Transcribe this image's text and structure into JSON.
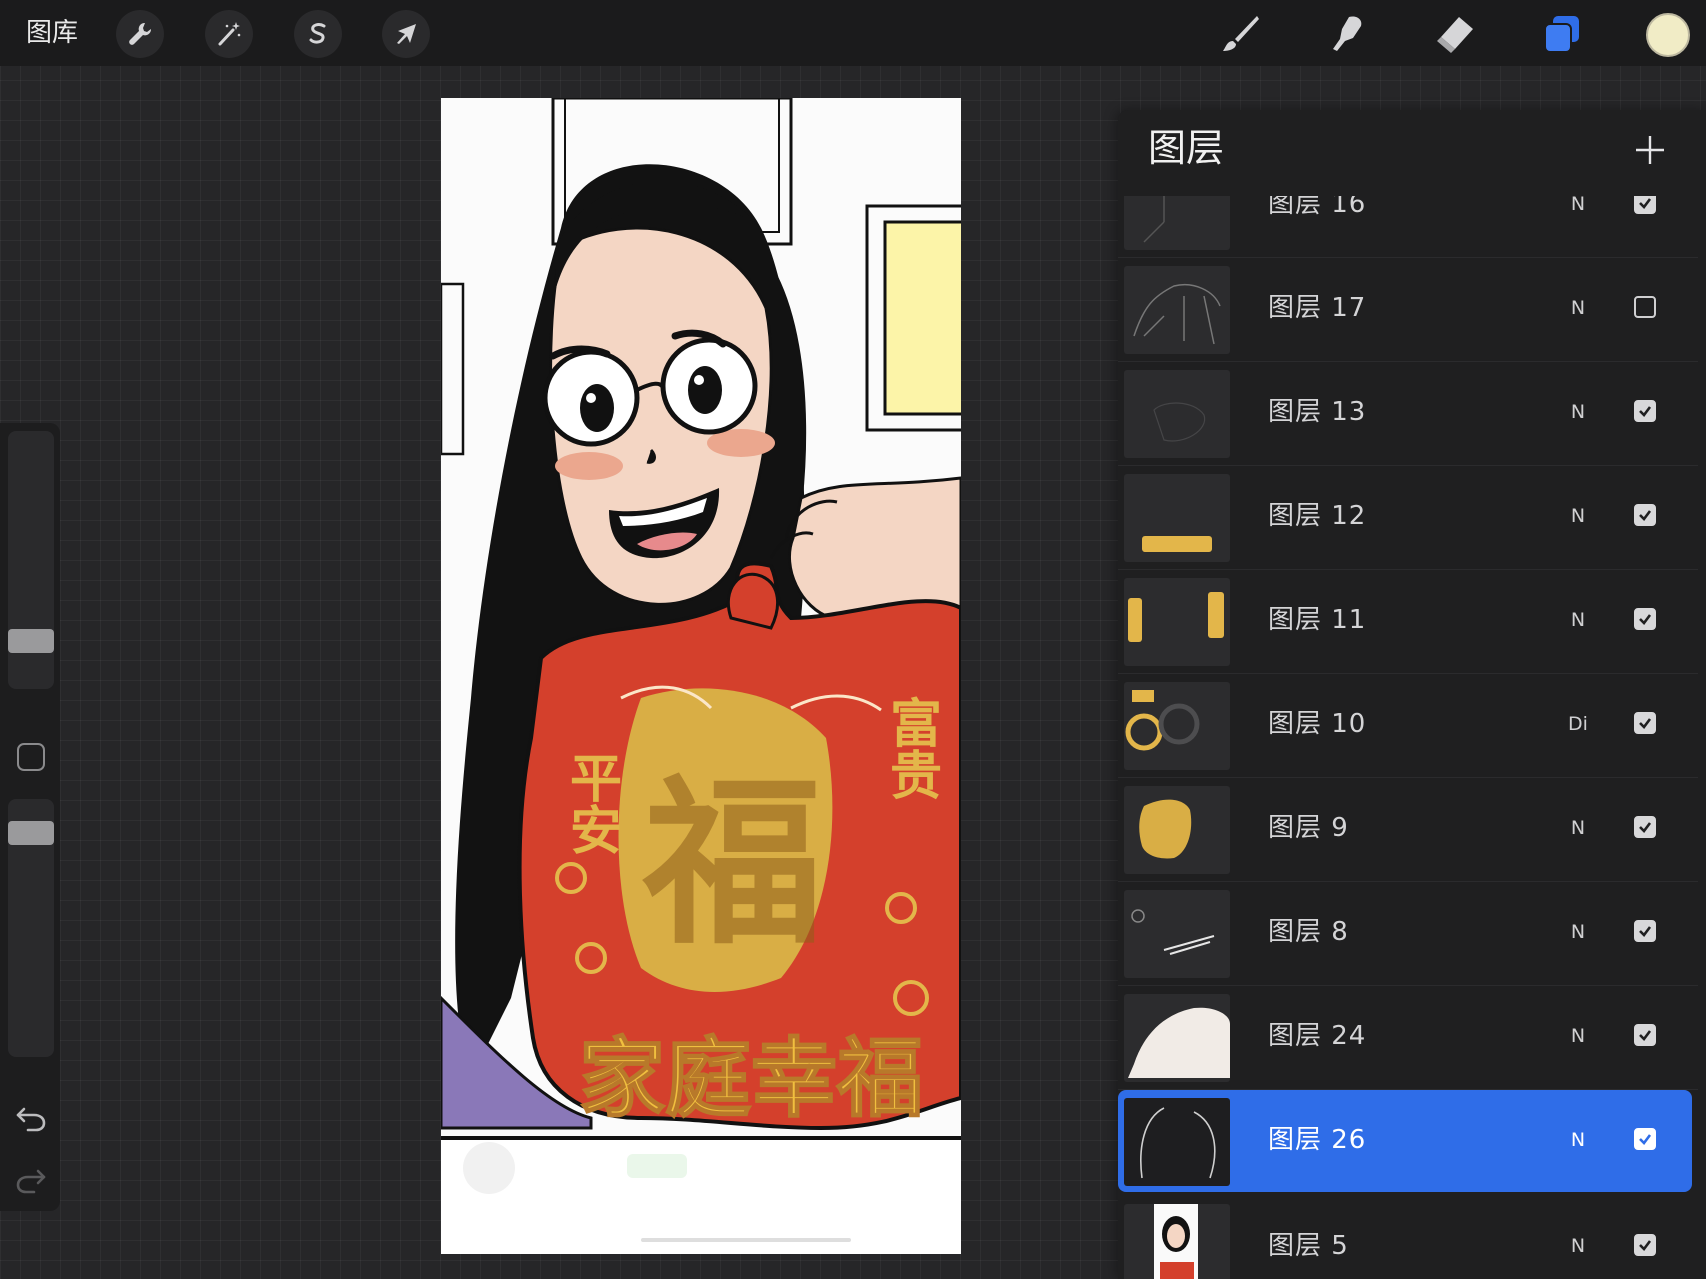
{
  "toolbar": {
    "gallery_label": "图库",
    "left_tools": [
      {
        "icon": "wrench-icon",
        "name": "actions-button"
      },
      {
        "icon": "magic-wand-icon",
        "name": "adjustments-button"
      },
      {
        "icon": "selection-s-icon",
        "name": "selection-button"
      },
      {
        "icon": "arrow-cursor-icon",
        "name": "transform-button"
      }
    ],
    "right_tools": [
      {
        "icon": "brush-icon",
        "name": "brush-button"
      },
      {
        "icon": "smudge-icon",
        "name": "smudge-button"
      },
      {
        "icon": "eraser-icon",
        "name": "eraser-button"
      },
      {
        "icon": "layers-icon",
        "name": "layers-button",
        "active": true
      }
    ],
    "active_color": "#f1ecc6"
  },
  "sidebar": {
    "brush_size_level": 0.2,
    "opacity_level": 1.0
  },
  "layers": {
    "title": "图层",
    "add_icon": "plus-icon",
    "items": [
      {
        "name": "图层 16",
        "blend": "N",
        "visible": true,
        "selected": false,
        "thumb": "sketch"
      },
      {
        "name": "图层 17",
        "blend": "N",
        "visible": false,
        "selected": false,
        "thumb": "lineart"
      },
      {
        "name": "图层 13",
        "blend": "N",
        "visible": true,
        "selected": false,
        "thumb": "faint"
      },
      {
        "name": "图层 12",
        "blend": "N",
        "visible": true,
        "selected": false,
        "thumb": "text-gold"
      },
      {
        "name": "图层 11",
        "blend": "N",
        "visible": true,
        "selected": false,
        "thumb": "side-gold"
      },
      {
        "name": "图层 10",
        "blend": "Di",
        "visible": true,
        "selected": false,
        "thumb": "pattern"
      },
      {
        "name": "图层 9",
        "blend": "N",
        "visible": true,
        "selected": false,
        "thumb": "fu"
      },
      {
        "name": "图层 8",
        "blend": "N",
        "visible": true,
        "selected": false,
        "thumb": "white-marks"
      },
      {
        "name": "图层 24",
        "blend": "N",
        "visible": true,
        "selected": false,
        "thumb": "hand"
      },
      {
        "name": "图层 26",
        "blend": "N",
        "visible": true,
        "selected": true,
        "thumb": "hair"
      },
      {
        "name": "图层 5",
        "blend": "N",
        "visible": true,
        "selected": false,
        "thumb": "girl"
      }
    ]
  },
  "artwork": {
    "bag_left_text": "平安",
    "bag_right_text": "富贵",
    "bag_center_text": "福",
    "bag_bottom_text": "家庭幸福",
    "colors": {
      "bag_red": "#d4402c",
      "gold": "#e3b64a",
      "skin": "#f4d6c4",
      "frame_yellow": "#fcf4a8",
      "shirt_purple": "#8a78b8",
      "blush": "#eba78e"
    }
  }
}
